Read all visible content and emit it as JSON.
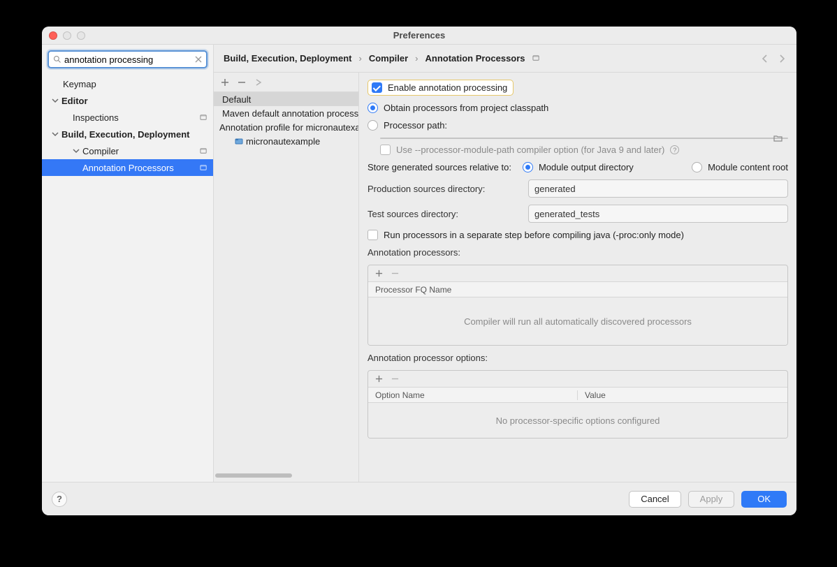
{
  "window": {
    "title": "Preferences"
  },
  "search": {
    "value": "annotation processing"
  },
  "sidebar": {
    "items": [
      {
        "label": "Keymap",
        "indent": 1
      },
      {
        "label": "Editor",
        "indent": 0,
        "bold": true,
        "chev": true
      },
      {
        "label": "Inspections",
        "indent": 2,
        "tag": true
      },
      {
        "label": "Build, Execution, Deployment",
        "indent": 0,
        "bold": true,
        "chev": true
      },
      {
        "label": "Compiler",
        "indent": 2,
        "chev": true,
        "tag": true
      },
      {
        "label": "Annotation Processors",
        "indent": 3,
        "selected": true,
        "tag": true
      }
    ]
  },
  "breadcrumb": {
    "a": "Build, Execution, Deployment",
    "b": "Compiler",
    "c": "Annotation Processors"
  },
  "profiles": {
    "items": [
      {
        "label": "Default",
        "sel": true
      },
      {
        "label": "Maven default annotation processors"
      },
      {
        "label": "Annotation profile for micronautexample",
        "chev": true
      },
      {
        "label": "micronautexample",
        "child": true,
        "module": true
      }
    ]
  },
  "form": {
    "enable_label": "Enable annotation processing",
    "obtain_classpath": "Obtain processors from project classpath",
    "processor_path_label": "Processor path:",
    "processor_path_value": "",
    "module_path_opt": "Use --processor-module-path compiler option (for Java 9 and later)",
    "store_label": "Store generated sources relative to:",
    "store_opt_a": "Module output directory",
    "store_opt_b": "Module content root",
    "prod_label": "Production sources directory:",
    "prod_value": "generated",
    "test_label": "Test sources directory:",
    "test_value": "generated_tests",
    "separate_step": "Run processors in a separate step before compiling java (-proc:only mode)",
    "processors_section": "Annotation processors:",
    "processors_col": "Processor FQ Name",
    "processors_empty": "Compiler will run all automatically discovered processors",
    "options_section": "Annotation processor options:",
    "options_col_a": "Option Name",
    "options_col_b": "Value",
    "options_empty": "No processor-specific options configured"
  },
  "footer": {
    "cancel": "Cancel",
    "apply": "Apply",
    "ok": "OK"
  }
}
